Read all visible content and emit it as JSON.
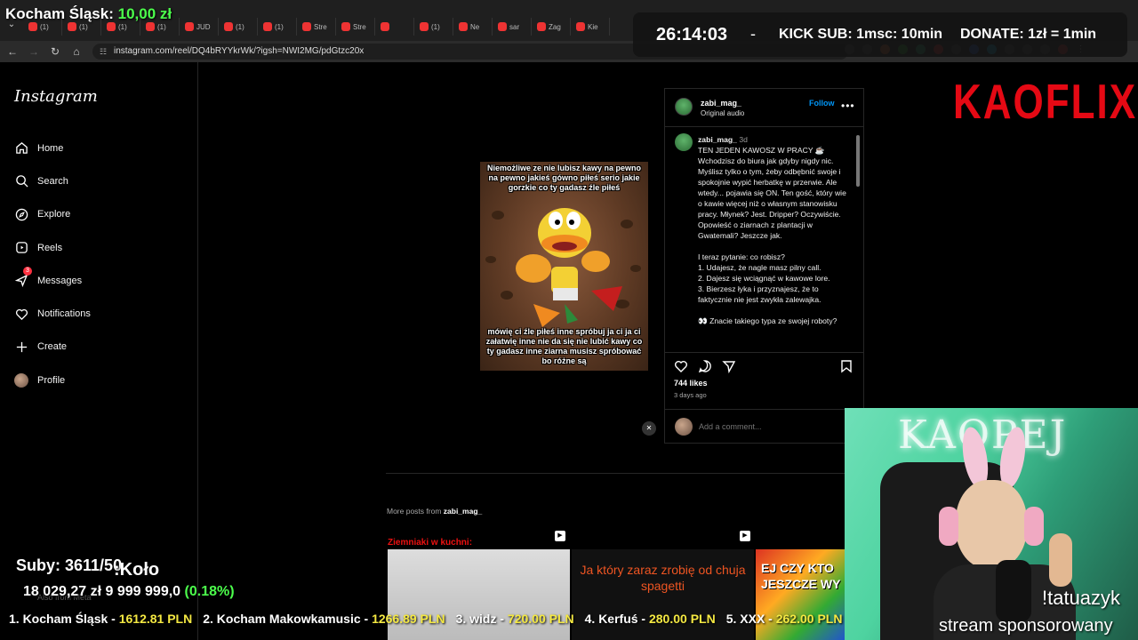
{
  "browser": {
    "tabs": [
      {
        "label": "(1)"
      },
      {
        "label": "(1)"
      },
      {
        "label": "(1)"
      },
      {
        "label": "(1)"
      },
      {
        "label": "JUD"
      },
      {
        "label": "(1)"
      },
      {
        "label": "(1)"
      },
      {
        "label": "Stre"
      },
      {
        "label": "Stre"
      },
      {
        "label": ""
      },
      {
        "label": "(1)"
      },
      {
        "label": "Ne"
      },
      {
        "label": "sar"
      },
      {
        "label": "Zag"
      },
      {
        "label": "Kie"
      }
    ],
    "url": "instagram.com/reel/DQ4bRYYkrWk/?igsh=NWI2MG/pdGtzc20x"
  },
  "overlay": {
    "goal_prefix": "Kocham Śląsk:",
    "goal_amount": "10,00 zł",
    "timer": "26:14:03",
    "separator": "-",
    "kick_sub": "KICK SUB: 1msc: 10min",
    "donate": "DONATE: 1zł = 1min",
    "brand": "KAOFLIX",
    "subs": "Suby: 3611/50",
    "kolo": ":Koło",
    "bank_amount": "18 029,27 zł",
    "bank_goal": "9 999 999,0",
    "bank_pct": "(0.18%)",
    "meta_text": "Also from Meta",
    "cam_neon": "KAOPEJ",
    "cam_user": "!tatuazyk",
    "cam_sponsor": "stream sponsorowany",
    "ticker": [
      {
        "rank": "1. Kocham Śląsk -",
        "amount": "1612.81 PLN"
      },
      {
        "rank": "2. Kocham Makowkamusic -",
        "amount": "1266.89 PLN"
      },
      {
        "rank": "3. widz -",
        "amount": "720.00 PLN"
      },
      {
        "rank": "4. Kerfuś -",
        "amount": "280.00 PLN"
      },
      {
        "rank": "5. XXX -",
        "amount": "262.00 PLN"
      }
    ]
  },
  "sidebar": {
    "logo": "Instagram",
    "items": [
      {
        "label": "Home",
        "icon": "home-icon"
      },
      {
        "label": "Search",
        "icon": "search-icon"
      },
      {
        "label": "Explore",
        "icon": "compass-icon"
      },
      {
        "label": "Reels",
        "icon": "reels-icon"
      },
      {
        "label": "Messages",
        "icon": "messenger-icon",
        "badge": "3"
      },
      {
        "label": "Notifications",
        "icon": "heart-icon"
      },
      {
        "label": "Create",
        "icon": "plus-icon"
      },
      {
        "label": "Profile",
        "icon": "avatar"
      }
    ]
  },
  "post": {
    "username": "zabi_mag_",
    "audio": "Original audio",
    "follow": "Follow",
    "meme_top": "Niemożliwe ze nie lubisz kawy na pewno na pewno jakieś gówno piłeś serio jakie gorzkie co ty gadasz źle piłeś",
    "meme_bottom": "mówię ci źle piłeś inne spróbuj ja ci ja ci załatwię inne nie da się nie lubić kawy co ty gadasz inne ziarna musisz spróbować bo różne są",
    "caption_user": "zabi_mag_",
    "caption_time": "3d",
    "caption_lines": [
      "TEN JEDEN KAWOSZ W PRACY ☕",
      "Wchodzisz do biura jak gdyby nigdy nic. Myślisz tylko o tym, żeby odbębnić swoje i spokojnie wypić herbatkę w przerwie. Ale wtedy... pojawia się ON. Ten gość, który wie o kawie więcej niż o własnym stanowisku pracy. Młynek? Jest. Dripper? Oczywiście. Opowieść o ziarnach z plantacji w Gwatemali? Jeszcze jak.",
      "",
      "I teraz pytanie: co robisz?",
      "1. Udajesz, że nagle masz pilny call.",
      "2. Dajesz się wciągnąć w kawowe lore.",
      "3. Bierzesz łyka i przyznajesz, że to faktycznie nie jest zwykła zalewajka.",
      "",
      "👀 Znacie takiego typa ze swojej roboty?"
    ],
    "likes": "744 likes",
    "ago": "3 days ago",
    "comment_placeholder": "Add a comment..."
  },
  "more": {
    "prefix": "More posts from",
    "user": "zabi_mag_",
    "thumbs": [
      {
        "text": "Ziemniaki w kuchni:"
      },
      {
        "text": "Ja który zaraz zrobię od chuja spagetti"
      },
      {
        "text": "EJ CZY KTO JESZCZE WY"
      }
    ]
  }
}
